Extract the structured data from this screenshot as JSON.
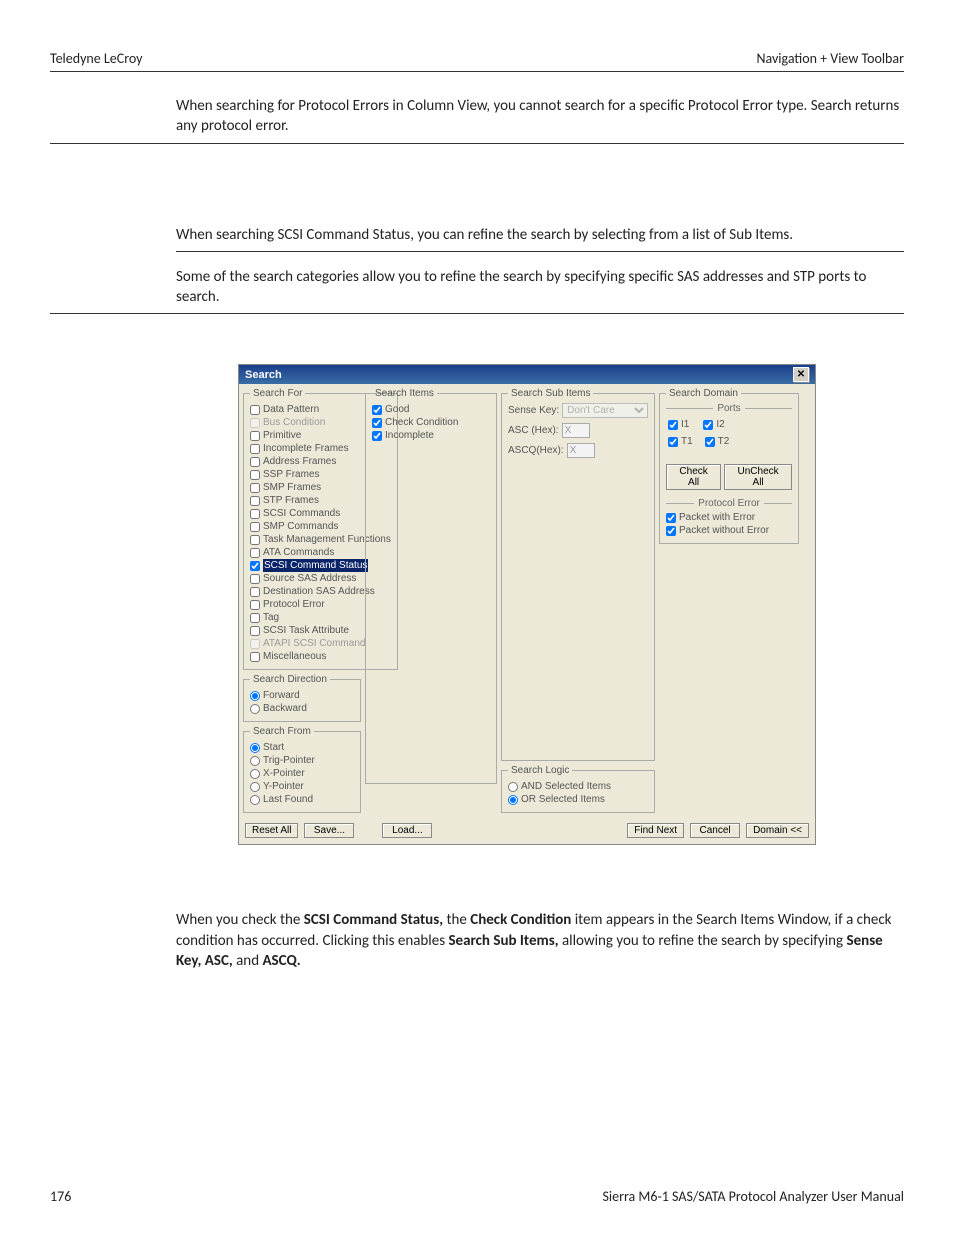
{
  "header": {
    "left": "Teledyne LeCroy",
    "right": "Navigation + View Toolbar"
  },
  "para1": "When searching for Protocol Errors in Column View, you cannot search for a specific Protocol Error type. Search returns any protocol error.",
  "para2": "When searching SCSI Command Status, you can refine the search by selecting from a list of Sub Items.",
  "para3": "Some of the search categories allow you to refine the search by specifying specific SAS addresses and STP ports to search.",
  "para4_parts": {
    "a": "When you check the ",
    "b": "SCSI Command Status,",
    "c": " the ",
    "d": "Check Condition",
    "e": " item appears in the Search Items Window, if a check condition has occurred. Clicking this enables ",
    "f": "Search Sub Items,",
    "g": " allowing you to refine the search by specifying ",
    "h": "Sense Key, ASC,",
    "i": " and ",
    "j": "ASCQ."
  },
  "dialog": {
    "title": "Search",
    "groups": {
      "search_for": "Search For",
      "search_items": "Search Items",
      "search_sub_items": "Search Sub Items",
      "search_logic": "Search Logic",
      "search_domain": "Search Domain",
      "search_direction": "Search Direction",
      "search_from": "Search From",
      "ports": "Ports",
      "protocol_error": "Protocol Error"
    },
    "search_for_items": [
      {
        "label": "Data Pattern",
        "checked": false
      },
      {
        "label": "Bus Condition",
        "checked": false,
        "disabled": true
      },
      {
        "label": "Primitive",
        "checked": false
      },
      {
        "label": "Incomplete Frames",
        "checked": false
      },
      {
        "label": "Address Frames",
        "checked": false
      },
      {
        "label": "SSP Frames",
        "checked": false
      },
      {
        "label": "SMP Frames",
        "checked": false
      },
      {
        "label": "STP Frames",
        "checked": false
      },
      {
        "label": "SCSI Commands",
        "checked": false
      },
      {
        "label": "SMP Commands",
        "checked": false
      },
      {
        "label": "Task Management Functions",
        "checked": false
      },
      {
        "label": "ATA Commands",
        "checked": false
      },
      {
        "label": "SCSI Command Status",
        "checked": true,
        "highlighted": true
      },
      {
        "label": "Source SAS Address",
        "checked": false
      },
      {
        "label": "Destination SAS Address",
        "checked": false
      },
      {
        "label": "Protocol Error",
        "checked": false
      },
      {
        "label": "Tag",
        "checked": false
      },
      {
        "label": "SCSI Task Attribute",
        "checked": false
      },
      {
        "label": "ATAPI SCSI Command",
        "checked": false,
        "disabled": true
      },
      {
        "label": "Miscellaneous",
        "checked": false
      }
    ],
    "search_items_list": [
      {
        "label": "Good",
        "checked": true
      },
      {
        "label": "Check Condition",
        "checked": true
      },
      {
        "label": "Incomplete",
        "checked": true
      }
    ],
    "sub_items": {
      "sense_key_label": "Sense Key:",
      "sense_key_value": "Don't Care",
      "asc_label": "ASC (Hex):",
      "asc_value": "X",
      "ascq_label": "ASCQ(Hex):",
      "ascq_value": "X"
    },
    "search_logic": {
      "and": "AND Selected Items",
      "or": "OR Selected Items"
    },
    "direction": {
      "forward": "Forward",
      "backward": "Backward"
    },
    "from": {
      "start": "Start",
      "trig": "Trig-Pointer",
      "x": "X-Pointer",
      "y": "Y-Pointer",
      "last": "Last Found"
    },
    "ports": {
      "i1": "I1",
      "i2": "I2",
      "t1": "T1",
      "t2": "T2"
    },
    "port_buttons": {
      "check_all": "Check All",
      "uncheck_all": "UnCheck All"
    },
    "protocol_error": {
      "with": "Packet with Error",
      "without": "Packet without Error"
    },
    "buttons": {
      "reset": "Reset All",
      "save": "Save...",
      "load": "Load...",
      "find": "Find Next",
      "cancel": "Cancel",
      "domain": "Domain <<"
    }
  },
  "footer": {
    "page": "176",
    "manual": "Sierra M6-1 SAS/SATA Protocol Analyzer User Manual"
  }
}
